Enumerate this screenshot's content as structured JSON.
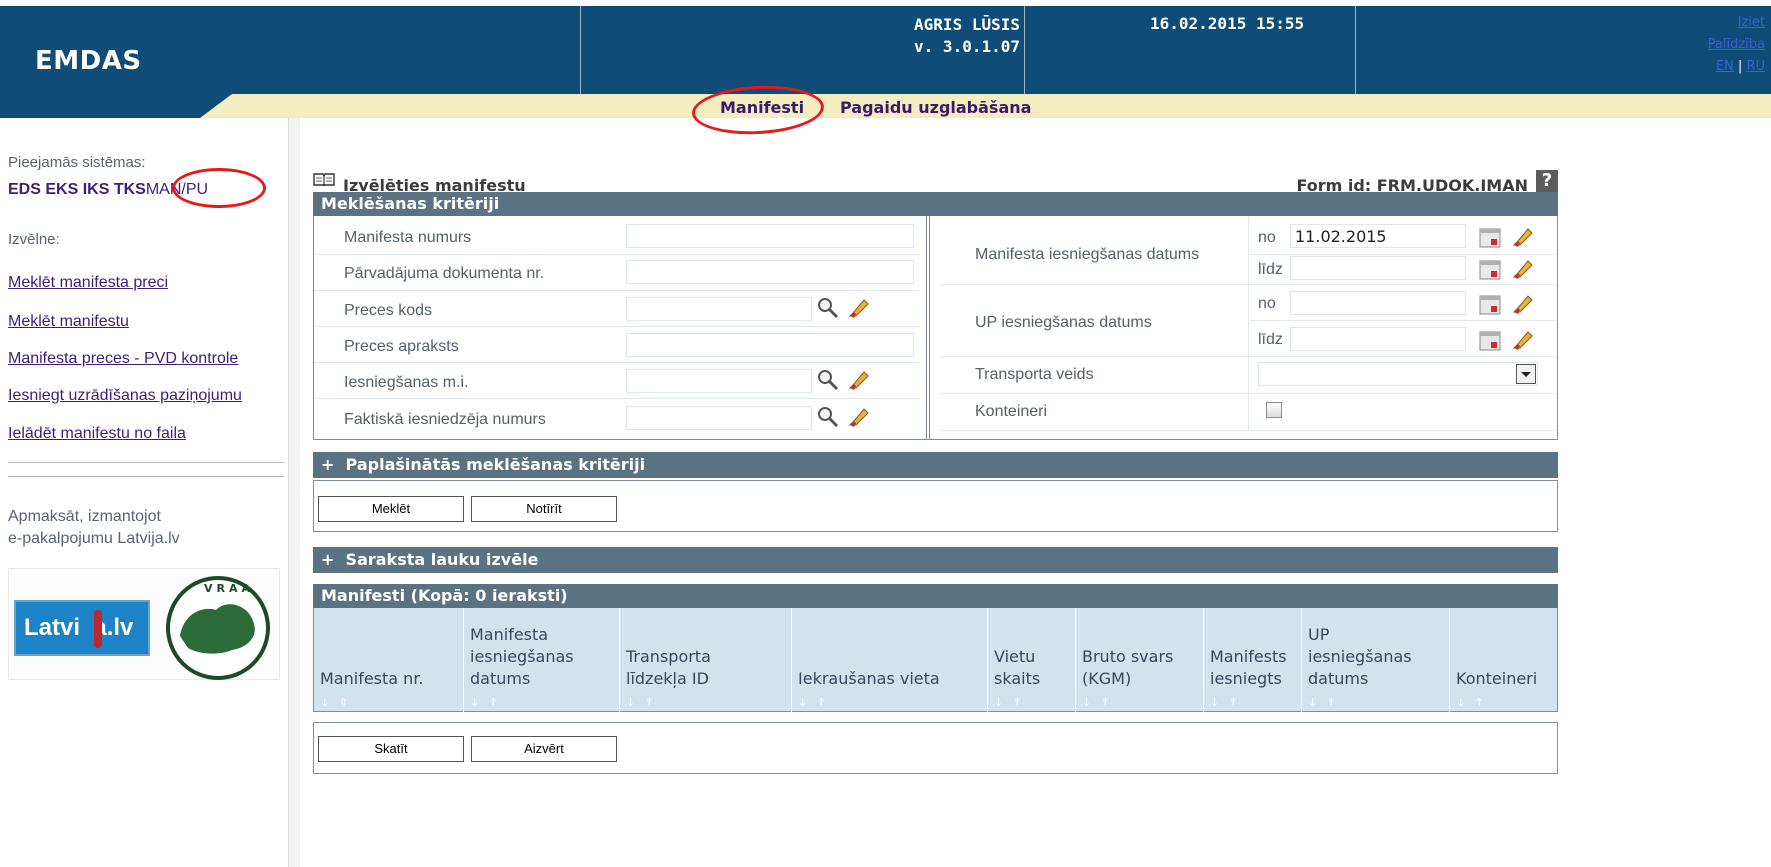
{
  "header": {
    "brand": "EMDAS",
    "user_name": "AGRIS LŪSIS",
    "version": "v. 3.0.1.07",
    "datetime": "16.02.2015 15:55",
    "logout": "Iziet",
    "help": "Palīdzība",
    "lang_en": "EN",
    "lang_sep": "|",
    "lang_ru": "RU",
    "colors": {
      "band": "#0f4d78",
      "tabbar": "#f3edc0"
    }
  },
  "tabs": [
    {
      "label": "Manifesti",
      "active": true
    },
    {
      "label": "Pagaidu uzglabāšana",
      "active": false
    }
  ],
  "sidebar": {
    "available_label": "Pieejamās sistēmas:",
    "systems": [
      "EDS",
      "EKS",
      "IKS",
      "TKS",
      "MAN/PU"
    ],
    "menu_label": "Izvēlne:",
    "menu_items": [
      "Meklēt manifesta preci",
      "Meklēt manifestu",
      "Manifesta preces - PVD kontrole",
      "Iesniegt uzrādīšanas paziņojumu",
      "Ielādēt manifestu no faila"
    ],
    "pay_line1": "Apmaksāt, izmantojot",
    "pay_line2": "e-pakalpojumu Latvija.lv",
    "logo_text": "Latvija.lv",
    "vraa_text": "VRAA"
  },
  "main": {
    "title": "Izvēlēties manifestu",
    "form_id": "Form id: FRM.UDOK.IMAN",
    "help_glyph": "?",
    "criteria": {
      "title": "Meklēšanas kritēriji",
      "left_fields": [
        {
          "label": "Manifesta numurs",
          "value": ""
        },
        {
          "label": "Pārvadājuma dokumenta nr.",
          "value": ""
        },
        {
          "label": "Preces kods",
          "value": ""
        },
        {
          "label": "Preces apraksts",
          "value": ""
        },
        {
          "label": "Iesniegšanas m.i.",
          "value": ""
        },
        {
          "label": "Faktiskā iesniedzēja numurs",
          "value": ""
        }
      ],
      "right_fields": {
        "manifest_date": {
          "label": "Manifesta iesniegšanas datums",
          "from_label": "no",
          "from_value": "11.02.2015",
          "to_label": "līdz",
          "to_value": ""
        },
        "up_date": {
          "label": "UP iesniegšanas datums",
          "from_label": "no",
          "from_value": "",
          "to_label": "līdz",
          "to_value": ""
        },
        "transport": {
          "label": "Transporta veids",
          "value": ""
        },
        "containers": {
          "label": "Konteineri",
          "checked": false
        }
      }
    },
    "extended_title": "Paplašinātās meklēšanas kritēriji",
    "expand_glyph": "+",
    "search_button": "Meklēt",
    "clear_button": "Notīrīt",
    "fields_title": "Saraksta lauku izvēle",
    "list_title": "Manifesti (Kopā: 0 ieraksti)",
    "columns": [
      {
        "label": "Manifesta nr.",
        "sort": "↓ ⇧"
      },
      {
        "label": "Manifesta\niesniegšanas\ndatums",
        "sort": "↓ ↑"
      },
      {
        "label": "Transporta\nlīdzekļa ID",
        "sort": "↓ ↑"
      },
      {
        "label": "Iekraušanas vieta",
        "sort": "↓ ↑"
      },
      {
        "label": "Vietu\nskaits",
        "sort": "↓ ↑"
      },
      {
        "label": "Bruto svars\n(KGM)",
        "sort": "↓ ↑"
      },
      {
        "label": "Manifests\niesniegts",
        "sort": "↓ ↑"
      },
      {
        "label": "UP\niesniegšanas\ndatums",
        "sort": "↓ ↑"
      },
      {
        "label": "Konteineri",
        "sort": "↓ ↑"
      }
    ],
    "view_button": "Skatīt",
    "close_button": "Aizvērt"
  }
}
